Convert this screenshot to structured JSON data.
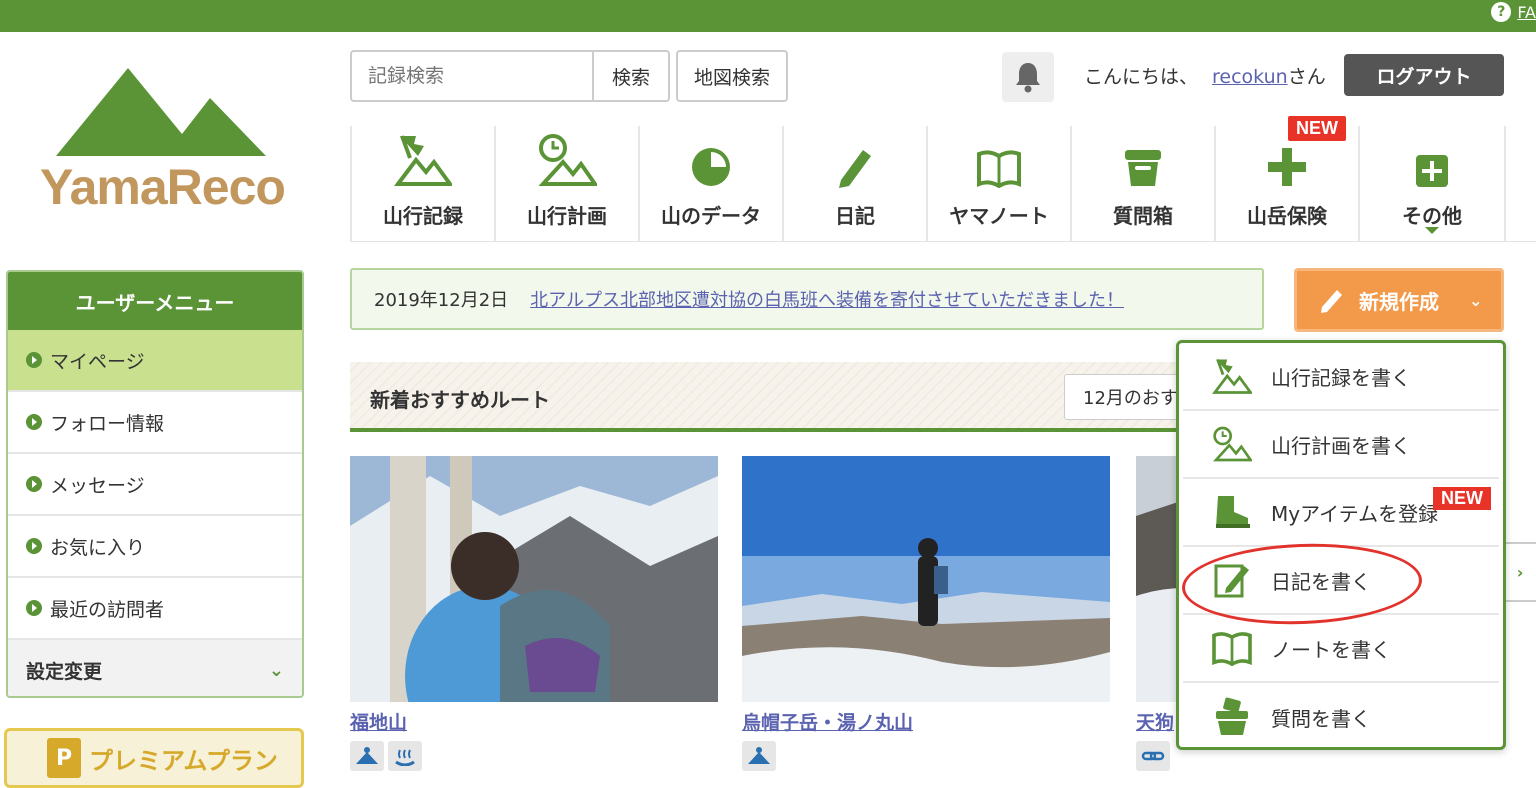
{
  "faq": {
    "label": "FA"
  },
  "logo": {
    "text": "YamaReco"
  },
  "search": {
    "placeholder": "記録検索",
    "button": "検索",
    "map_button": "地図検索"
  },
  "header": {
    "greeting": "こんにちは、",
    "username": "recokun",
    "suffix": "さん",
    "logout": "ログアウト"
  },
  "nav": [
    {
      "label": "山行記録",
      "icon": "mountain-flag-icon"
    },
    {
      "label": "山行計画",
      "icon": "clock-mountain-icon"
    },
    {
      "label": "山のデータ",
      "icon": "pie-chart-icon"
    },
    {
      "label": "日記",
      "icon": "pencil-icon"
    },
    {
      "label": "ヤマノート",
      "icon": "book-icon"
    },
    {
      "label": "質問箱",
      "icon": "box-icon"
    },
    {
      "label": "山岳保険",
      "icon": "plus-icon",
      "badge": "NEW"
    },
    {
      "label": "その他",
      "icon": "plus-square-icon"
    }
  ],
  "sidebar": {
    "title": "ユーザーメニュー",
    "items": [
      "マイページ",
      "フォロー情報",
      "メッセージ",
      "お気に入り",
      "最近の訪問者"
    ],
    "settings": "設定変更"
  },
  "premium": {
    "label": "プレミアムプラン",
    "badge": "P"
  },
  "news": {
    "date": "2019年12月2日",
    "text": "北アルプス北部地区遭対協の白馬班へ装備を寄付させていただきました！"
  },
  "create": {
    "label": "新規作成"
  },
  "section": {
    "title": "新着おすすめルート",
    "select": "12月のおす"
  },
  "cards": [
    {
      "title": "福地山"
    },
    {
      "title": "烏帽子岳・湯ノ丸山"
    },
    {
      "title": "天狗"
    }
  ],
  "dropdown": {
    "items": [
      {
        "label": "山行記録を書く",
        "icon": "mountain-flag-icon"
      },
      {
        "label": "山行計画を書く",
        "icon": "clock-mountain-icon"
      },
      {
        "label": "Myアイテムを登録",
        "icon": "boot-icon",
        "badge": "NEW"
      },
      {
        "label": "日記を書く",
        "icon": "diary-pencil-icon"
      },
      {
        "label": "ノートを書く",
        "icon": "book-icon"
      },
      {
        "label": "質問を書く",
        "icon": "question-box-icon"
      }
    ]
  },
  "colors": {
    "brand": "#5a9437",
    "accent": "#f2994a",
    "badge": "#e83328",
    "link": "#5b63b0"
  }
}
